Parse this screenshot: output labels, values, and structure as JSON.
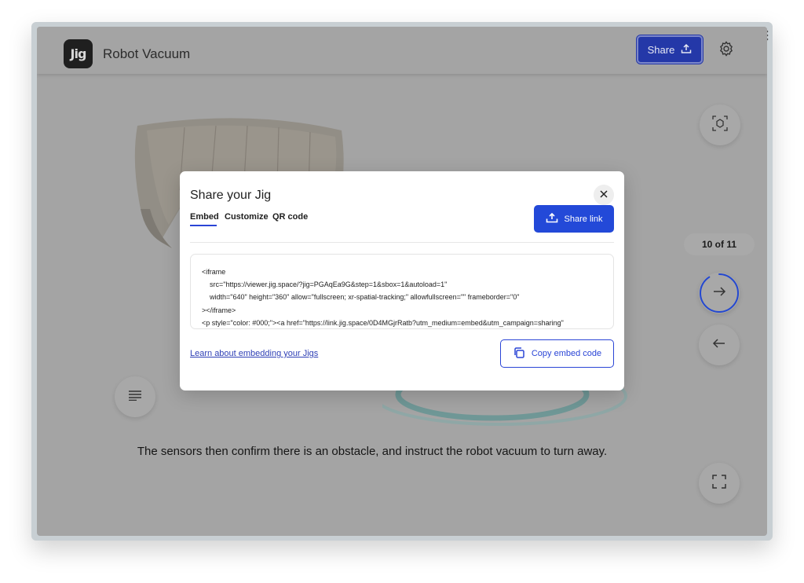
{
  "app": {
    "logo_text": "Jig",
    "title": "Robot Vacuum",
    "share_label": "Share",
    "page_counter": "10 of 11",
    "caption": "The sensors then confirm there is an obstacle, and instruct the robot vacuum to turn away.",
    "progress_fraction": 0.91
  },
  "modal": {
    "title": "Share your Jig",
    "tabs": [
      {
        "label": "Embed",
        "active": true
      },
      {
        "label": "Customize",
        "active": false
      },
      {
        "label": "QR code",
        "active": false
      }
    ],
    "share_link_label": "Share link",
    "code_lines": [
      "<iframe",
      "    src=\"https://viewer.jig.space/?jig=PGAqEa9G&step=1&sbox=1&autoload=1\"",
      "    width=\"640\" height=\"360\" allow=\"fullscreen; xr-spatial-tracking;\" allowfullscreen=\"\" frameborder=\"0\"",
      "></iframe>",
      "<p style=\"color: #000;\"><a href=\"https://link.jig.space/0D4MGjrRatb?utm_medium=embed&utm_campaign=sharing\""
    ],
    "learn_link": "Learn about embedding your Jigs",
    "copy_label": "Copy embed code"
  },
  "icons": {
    "share": "upload-icon",
    "settings": "gear-icon",
    "ar": "ar-scan-icon",
    "next": "arrow-right-icon",
    "prev": "arrow-left-icon",
    "notes": "text-lines-icon",
    "fullscreen": "fullscreen-icon",
    "close": "close-icon",
    "copy": "copy-icon"
  },
  "colors": {
    "primary": "#2349d8",
    "overlay_bg": "#a4a4a4",
    "modal_bg": "#ffffff"
  }
}
